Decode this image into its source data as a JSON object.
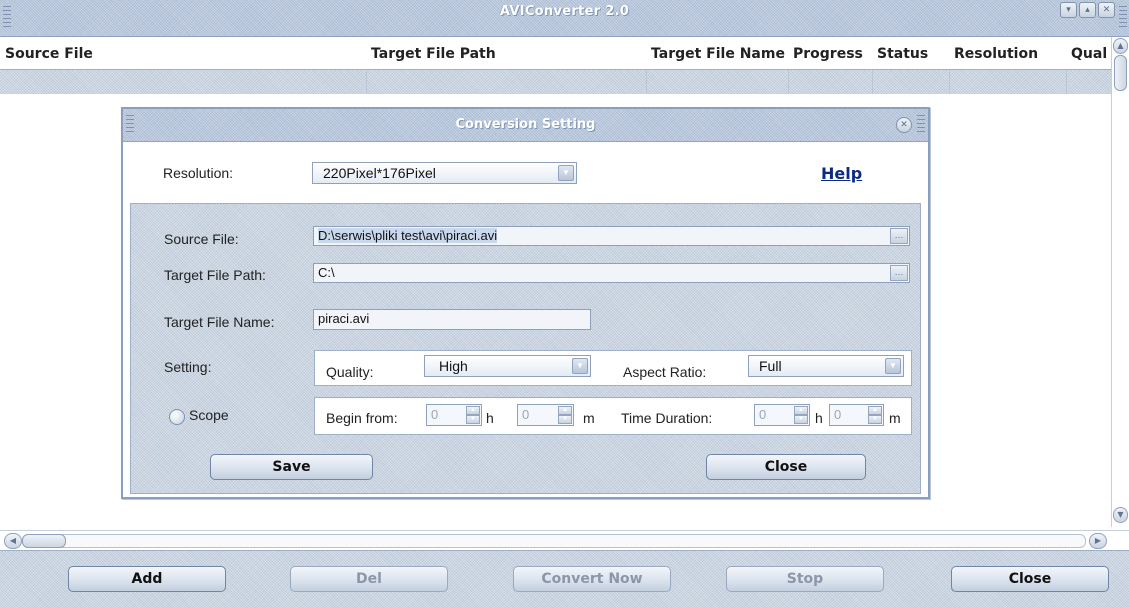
{
  "app": {
    "title": "AVIConverter 2.0"
  },
  "window_buttons": {
    "minimize": "▾",
    "maximize": "▴",
    "close": "✕"
  },
  "table": {
    "columns": [
      "Source File",
      "Target File Path",
      "Target File Name",
      "Progress",
      "Status",
      "Resolution",
      "Qual"
    ]
  },
  "dialog": {
    "title": "Conversion Setting",
    "help": "Help",
    "resolution": {
      "label": "Resolution:",
      "value": "220Pixel*176Pixel"
    },
    "source_file": {
      "label": "Source File:",
      "value": "D:\\serwis\\pliki test\\avi\\piraci.avi"
    },
    "target_path": {
      "label": "Target File Path:",
      "value": "C:\\"
    },
    "target_name": {
      "label": "Target File Name:",
      "value": "piraci.avi"
    },
    "setting": {
      "label": "Setting:",
      "quality_label": "Quality:",
      "quality_value": "High",
      "aspect_label": "Aspect Ratio:",
      "aspect_value": "Full"
    },
    "scope": {
      "label": "Scope",
      "begin_label": "Begin from:",
      "begin_h": "0",
      "h_unit": "h",
      "begin_m": "0",
      "m_unit": "m",
      "duration_label": "Time Duration:",
      "duration_h": "0",
      "duration_m": "0"
    },
    "save_label": "Save",
    "close_label": "Close"
  },
  "bottom": {
    "add": "Add",
    "del": "Del",
    "convert": "Convert Now",
    "stop": "Stop",
    "close": "Close"
  },
  "icons": {
    "dialog_close": "✕",
    "browse": "…",
    "combo_arrow": "▼",
    "spin_up": "▲",
    "spin_down": "▼",
    "scroll_up": "▲",
    "scroll_down": "▼",
    "scroll_left": "◀",
    "scroll_right": "▶"
  },
  "colors": {
    "link": "#0b2a86",
    "title_bar": "#b6c6dc"
  }
}
